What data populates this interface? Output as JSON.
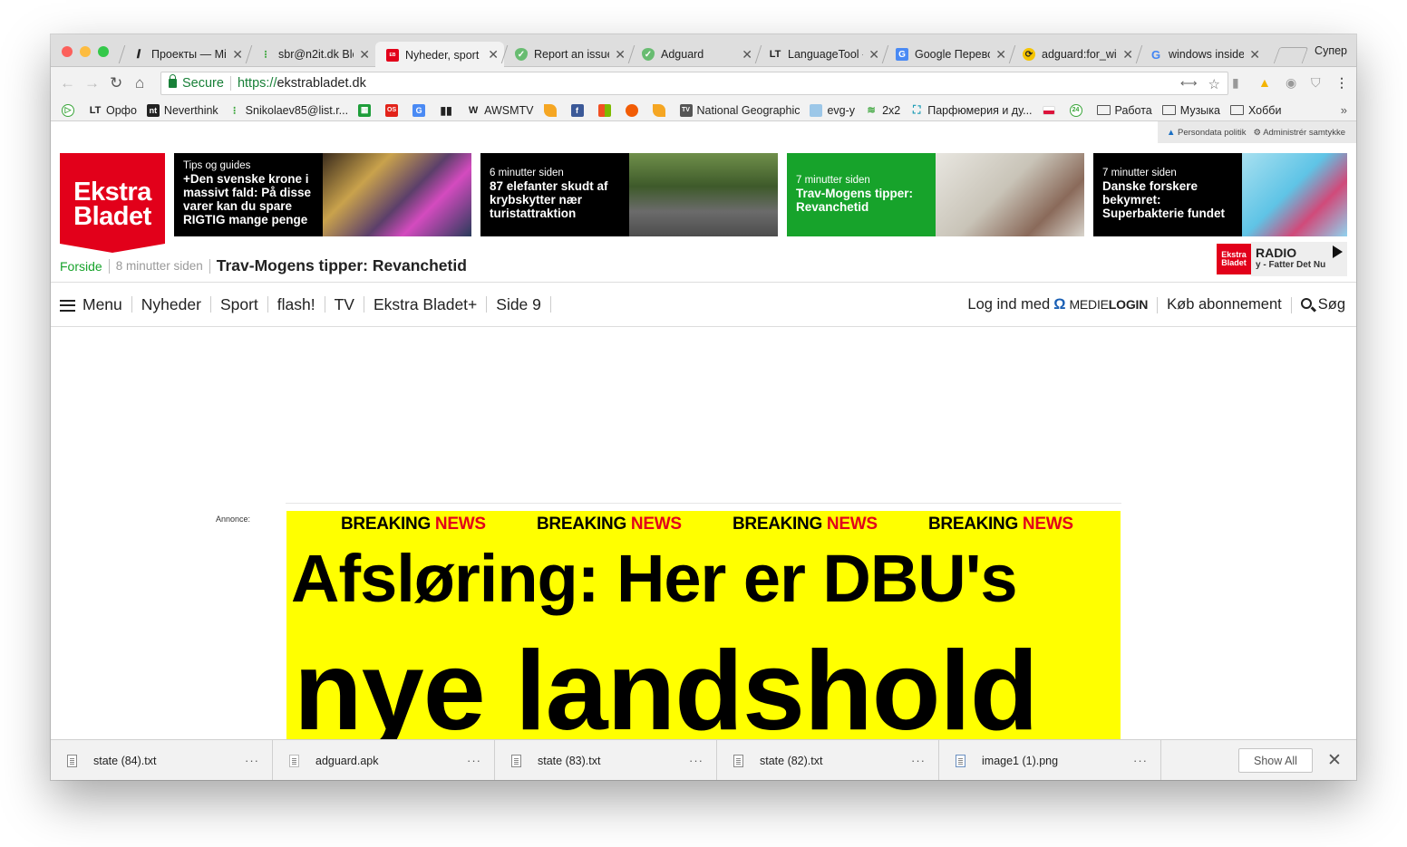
{
  "browser": {
    "tabs": [
      {
        "title": "Проекты — Mi",
        "icon": "writer-icon"
      },
      {
        "title": "sbr@n2it.dk Blc",
        "icon": "dots-icon"
      },
      {
        "title": "Nyheder, sport",
        "icon": "ekstrabladet-icon",
        "active": true
      },
      {
        "title": "Report an issue",
        "icon": "adguard-shield-icon"
      },
      {
        "title": "Adguard",
        "icon": "adguard-shield-icon"
      },
      {
        "title": "LanguageTool -",
        "icon": "lt-icon"
      },
      {
        "title": "Google Перевод",
        "icon": "google-translate-icon"
      },
      {
        "title": "adguard:for_win",
        "icon": "refresh-icon"
      },
      {
        "title": "windows inside",
        "icon": "google-icon"
      }
    ],
    "user_label": "Супер",
    "omnibox": {
      "secure_label": "Secure",
      "scheme": "https://",
      "host": "ekstrabladet.dk"
    },
    "bookmarks": [
      {
        "label": "",
        "icon": "play-circle-icon"
      },
      {
        "label": "Орфо",
        "icon": "lt-icon"
      },
      {
        "label": "Neverthink",
        "icon": "nt-icon"
      },
      {
        "label": "Snikolaev85@list.r...",
        "icon": "dots-icon"
      },
      {
        "label": "",
        "icon": "green-square-icon"
      },
      {
        "label": "",
        "icon": "os-icon"
      },
      {
        "label": "",
        "icon": "translate-icon"
      },
      {
        "label": "",
        "icon": "bars-icon"
      },
      {
        "label": "AWSMTV",
        "icon": "awsm-icon"
      },
      {
        "label": "",
        "icon": "leaf-icon"
      },
      {
        "label": "",
        "icon": "facebook-icon"
      },
      {
        "label": "",
        "icon": "microsoft-icon"
      },
      {
        "label": "",
        "icon": "circles-icon"
      },
      {
        "label": "",
        "icon": "leaf-icon"
      },
      {
        "label": "National Geographic",
        "icon": "tv-icon"
      },
      {
        "label": "evg-y",
        "icon": "image-icon"
      },
      {
        "label": "2x2",
        "icon": "2x2-icon"
      },
      {
        "label": "Парфюмерия и ду...",
        "icon": "bag-icon"
      },
      {
        "label": "",
        "icon": "flag-icon"
      },
      {
        "label": "",
        "icon": "24-icon"
      },
      {
        "label": "Работа",
        "icon": "folder-icon"
      },
      {
        "label": "Музыка",
        "icon": "folder-icon"
      },
      {
        "label": "Хобби",
        "icon": "folder-icon"
      }
    ],
    "bookmarks_more": "»"
  },
  "privacy": {
    "policy": "Persondata politik",
    "consent": "Administrér samtykke"
  },
  "logo": {
    "line1": "Ekstra",
    "line2": "Bladet"
  },
  "cards": [
    {
      "kicker": "Tips og guides",
      "headline": "+Den svenske krone i massivt fald: På disse varer kan du spare RIGTIG mange penge",
      "bg": "#000000"
    },
    {
      "kicker": "6 minutter siden",
      "headline": "87 elefanter skudt af krybskytter nær turistattraktion",
      "bg": "#000000"
    },
    {
      "kicker": "7 minutter siden",
      "headline": "Trav-Mogens tipper: Revanchetid",
      "bg": "#17a32b"
    },
    {
      "kicker": "7 minutter siden",
      "headline": "Danske forskere bekymret: Superbakterie fundet",
      "bg": "#000000"
    }
  ],
  "breadcrumb": {
    "home": "Forside",
    "time": "8 minutter siden",
    "title": "Trav-Mogens tipper: Revanchetid"
  },
  "radio": {
    "logo1": "Ekstra",
    "logo2": "Bladet",
    "label": "RADIO",
    "track": "y - Fatter Det Nu"
  },
  "nav": {
    "items": [
      "Menu",
      "Nyheder",
      "Sport",
      "flash!",
      "TV",
      "Ekstra Bladet+",
      "Side 9"
    ],
    "login_prefix": "Log ind med",
    "medie": "MEDIE",
    "login": "LOGIN",
    "subscribe": "Køb abonnement",
    "search": "Søg"
  },
  "ad": {
    "label": "Annonce:",
    "breaking": "BREAKING",
    "news": "NEWS",
    "headline1": "Afsløring: Her er DBU's",
    "headline2": "nye landshold"
  },
  "downloads": {
    "files": [
      "state (84).txt",
      "adguard.apk",
      "state (83).txt",
      "state (82).txt",
      "image1 (1).png"
    ],
    "show_all": "Show All",
    "close": "✕"
  },
  "colors": {
    "brand_red": "#e2001a",
    "brand_green": "#17a32b",
    "ad_yellow": "#ffff00",
    "secure_green": "#188038"
  }
}
